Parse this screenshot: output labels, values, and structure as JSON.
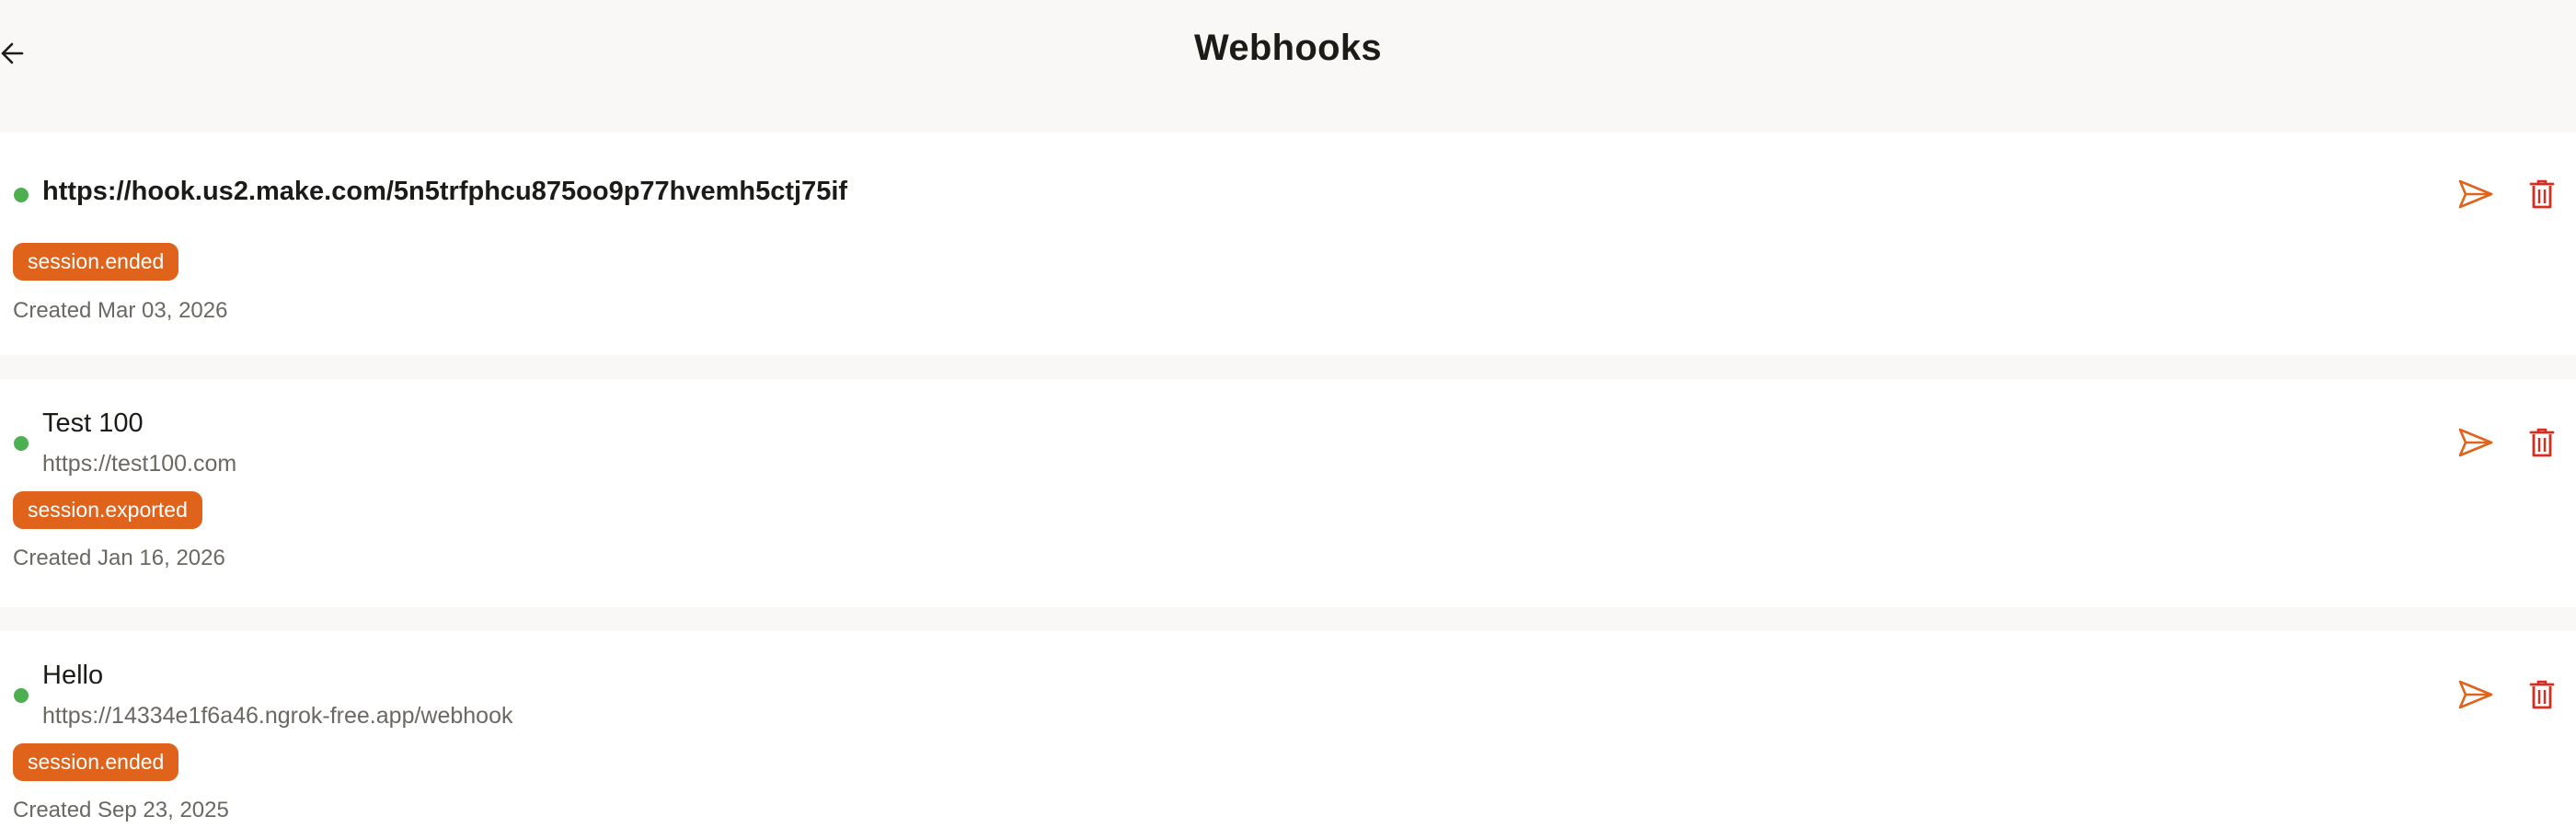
{
  "header": {
    "title": "Webhooks",
    "back_icon": "arrow-left-icon"
  },
  "colors": {
    "background": "#f9f8f6",
    "card": "#ffffff",
    "accent": "#e0631b",
    "delete": "#d62d20",
    "status_active": "#4caf50",
    "muted_text": "#6b6862"
  },
  "webhooks": [
    {
      "title": "https://hook.us2.make.com/5n5trfphcu875oo9p77hvemh5ctj75if",
      "url": "",
      "event": "session.ended",
      "created": "Created Mar 03, 2026",
      "status": "active",
      "send_icon": "send-icon",
      "delete_icon": "trash-icon"
    },
    {
      "title": "Test 100",
      "url": "https://test100.com",
      "event": "session.exported",
      "created": "Created Jan 16, 2026",
      "status": "active",
      "send_icon": "send-icon",
      "delete_icon": "trash-icon"
    },
    {
      "title": "Hello",
      "url": "https://14334e1f6a46.ngrok-free.app/webhook",
      "event": "session.ended",
      "created": "Created Sep 23, 2025",
      "status": "active",
      "send_icon": "send-icon",
      "delete_icon": "trash-icon"
    }
  ]
}
